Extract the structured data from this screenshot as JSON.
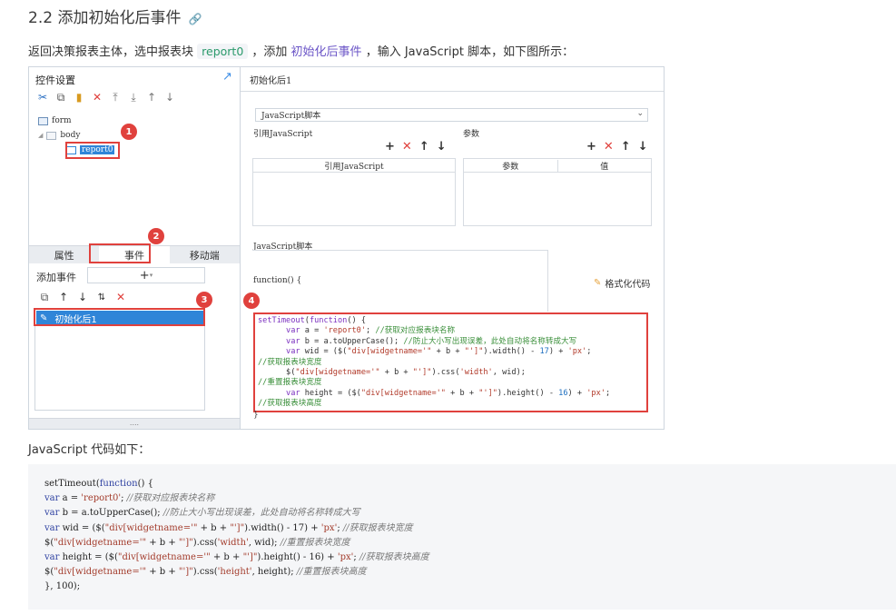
{
  "heading": {
    "text": "2.2 添加初始化后事件",
    "link_icon": "link-icon"
  },
  "intro": {
    "part1": "返回决策报表主体，选中报表块 ",
    "report": "report0",
    "part2": " ，添加 ",
    "event_link": "初始化后事件",
    "part3": " ，输入 JavaScript 脚本，如下图所示："
  },
  "screenshot": {
    "left": {
      "title": "控件设置",
      "tree": {
        "form": "form",
        "body": "body",
        "report": "report0"
      },
      "tabs": [
        "属性",
        "事件",
        "移动端"
      ],
      "add_event_label": "添加事件",
      "add_symbol": "+",
      "event_item": "初始化后1",
      "bottom_dots": "....",
      "badges": [
        "1",
        "2",
        "3"
      ]
    },
    "right": {
      "title": "初始化后1",
      "select_value": "JavaScript脚本",
      "ref_js_label": "引用JavaScript",
      "params_label": "参数",
      "ref_js_col": "引用JavaScript",
      "param_col": "参数",
      "value_col": "值",
      "script_label": "JavaScript脚本",
      "function_header": "function() {",
      "format_button": "格式化代码",
      "closing": "}",
      "badge": "4",
      "code_lines": [
        "setTimeout(function() {",
        "      var a = 'report0'; //获取对应报表块名称",
        "      var b = a.toUpperCase(); //防止大小写出现误差，此处自动将名称转成大写",
        "      var wid = ($(\"div[widgetname='\" + b + \"']\").width() - 17) + 'px';",
        "//获取报表块宽度",
        "      $(\"div[widgetname='\" + b + \"']\").css('width', wid);",
        "//重置报表块宽度",
        "      var height = ($(\"div[widgetname='\" + b + \"']\").height() - 16) + 'px';",
        "//获取报表块高度"
      ]
    }
  },
  "js_label": "JavaScript 代码如下：",
  "code_block": [
    "setTimeout(function() {",
    "var a = 'report0'; //获取对应报表块名称",
    "var b = a.toUpperCase(); //防止大小写出现误差，此处自动将名称转成大写",
    "var wid = ($(\"div[widgetname='\" + b + \"']\").width() - 17) + 'px'; //获取报表块宽度",
    "$(\"div[widgetname='\" + b + \"']\").css('width', wid); //重置报表块宽度",
    "var height = ($(\"div[widgetname='\" + b + \"']\").height() - 16) + 'px'; //获取报表块高度",
    "$(\"div[widgetname='\" + b + \"']\").css('height', height); //重置报表块高度",
    "}, 100);"
  ]
}
